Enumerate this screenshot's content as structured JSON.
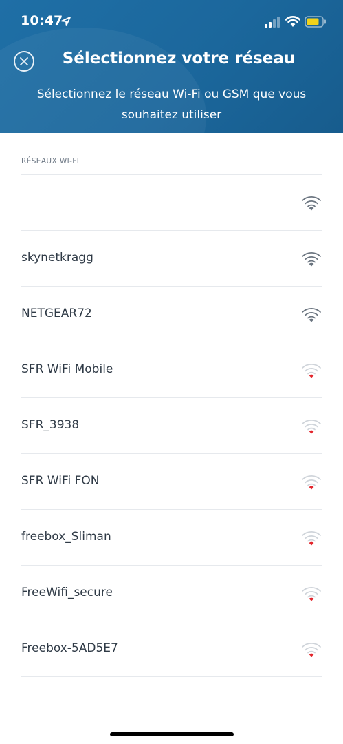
{
  "status_bar": {
    "time": "10:47"
  },
  "header": {
    "title": "Sélectionnez votre réseau",
    "subtitle": "Sélectionnez le réseau Wi-Fi ou GSM que vous souhaitez utiliser"
  },
  "section": {
    "label": "RÉSEAUX WI-FI"
  },
  "networks": [
    {
      "name": "",
      "signal": "strong"
    },
    {
      "name": "skynetkragg",
      "signal": "strong"
    },
    {
      "name": "NETGEAR72",
      "signal": "strong"
    },
    {
      "name": "SFR WiFi Mobile",
      "signal": "weak"
    },
    {
      "name": "SFR_3938",
      "signal": "weak"
    },
    {
      "name": "SFR WiFi FON",
      "signal": "weak"
    },
    {
      "name": "freebox_Sliman",
      "signal": "weak"
    },
    {
      "name": "FreeWifi_secure",
      "signal": "weak"
    },
    {
      "name": "Freebox-5AD5E7",
      "signal": "weak"
    }
  ],
  "icons": {
    "close": "close-icon",
    "wifi": "wifi-signal-icon",
    "location": "location-arrow-icon",
    "cellular": "cellular-signal-icon",
    "battery": "battery-icon"
  },
  "colors": {
    "header": "#1b679c",
    "strong_signal": "#6b7580",
    "weak_signal": "#e3262d",
    "faded_arc": "#cfd4da",
    "battery_fill": "#f2d21b"
  }
}
